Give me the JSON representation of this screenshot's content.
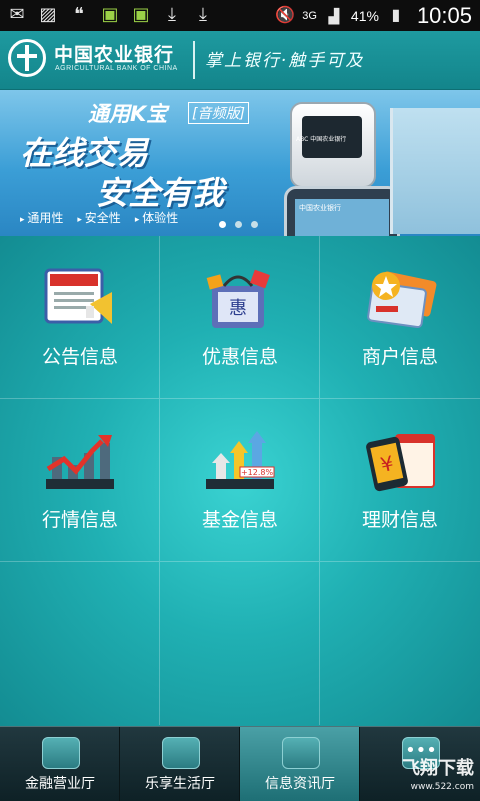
{
  "status_bar": {
    "left_icons": [
      "mail-icon",
      "image-icon",
      "quote-icon",
      "android-icon",
      "android-icon",
      "download-icon",
      "download-icon"
    ],
    "network": "3G",
    "battery": "41%",
    "time": "10:05"
  },
  "header": {
    "bank_name": "中国农业银行",
    "bank_name_en": "AGRICULTURAL BANK OF CHINA",
    "slogan": "掌上银行·触手可及"
  },
  "banner": {
    "product": "通用K宝",
    "product_tag": "[音频版]",
    "headline_1": "在线交易",
    "headline_2": "安全有我",
    "features": [
      "通用性",
      "安全性",
      "体验性"
    ],
    "device_text": "ABC 中国农业银行",
    "phone_text": "中国农业银行",
    "slides": 3,
    "active_slide": 0
  },
  "grid": {
    "items": [
      {
        "label": "公告信息",
        "icon": "announcement-board-icon"
      },
      {
        "label": "优惠信息",
        "icon": "discount-bag-icon"
      },
      {
        "label": "商户信息",
        "icon": "merchant-card-icon"
      },
      {
        "label": "行情信息",
        "icon": "market-chart-icon"
      },
      {
        "label": "基金信息",
        "icon": "fund-growth-icon",
        "badge": "+12.8%"
      },
      {
        "label": "理财信息",
        "icon": "wealth-phone-icon"
      }
    ]
  },
  "tabbar": {
    "tabs": [
      {
        "label": "金融营业厅",
        "icon": "briefcase-icon",
        "active": false
      },
      {
        "label": "乐享生活厅",
        "icon": "coffee-icon",
        "active": false
      },
      {
        "label": "信息资讯厅",
        "icon": "news-icon",
        "active": true
      },
      {
        "label": "",
        "icon": "more-icon",
        "active": false
      }
    ]
  },
  "watermark": {
    "title": "飞翔下载",
    "url": "www.522.com"
  }
}
